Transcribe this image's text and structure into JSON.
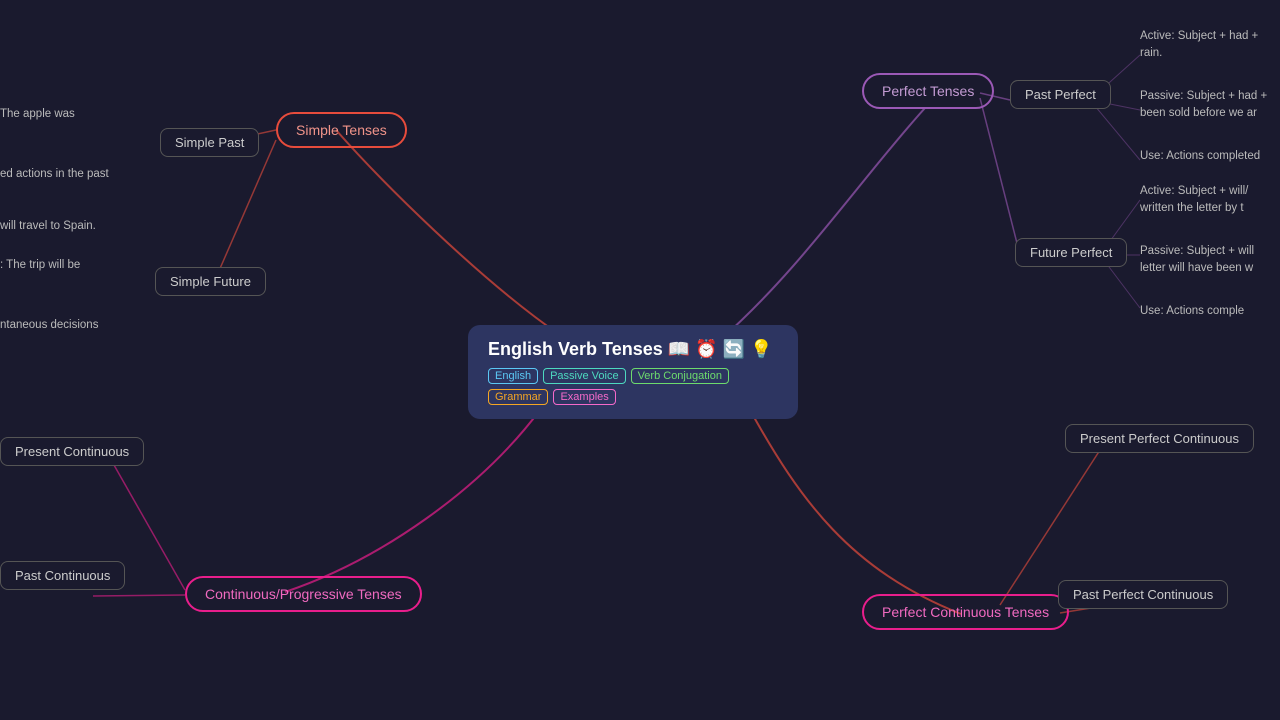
{
  "central": {
    "title": "English Verb Tenses 📖 ⏰ 🔄 💡",
    "tags": [
      {
        "label": "English",
        "class": "tag-blue"
      },
      {
        "label": "Passive Voice",
        "class": "tag-teal"
      },
      {
        "label": "Verb Conjugation",
        "class": "tag-green"
      },
      {
        "label": "Grammar",
        "class": "tag-orange"
      },
      {
        "label": "Examples",
        "class": "tag-pink"
      }
    ]
  },
  "nodes": {
    "simple_tenses": "Simple Tenses",
    "simple_past": "Simple Past",
    "simple_future": "Simple Future",
    "perfect_tenses": "Perfect Tenses",
    "past_perfect": "Past Perfect",
    "future_perfect": "Future Perfect",
    "continuous_tenses": "Continuous/Progressive Tenses",
    "present_continuous": "Present Continuous",
    "past_continuous": "Past Continuous",
    "perfect_continuous_tenses": "Perfect Continuous Tenses",
    "present_perfect_continuous": "Present Perfect Continuous",
    "past_perfect_continuous": "Past Perfect Continuous"
  },
  "text_nodes": {
    "apple": "The apple was",
    "ed_actions": "ed actions in the past",
    "will_travel": "will travel to Spain.",
    "trip_will": ": The trip will be",
    "instantaneous": "ntaneous decisions",
    "active_had": "Active: Subject + had +",
    "active_had2": "rain.",
    "passive_had": "Passive: Subject + had +",
    "passive_had2": "been sold before we ar",
    "use_actions_completed": "Use: Actions completed",
    "active_will": "Active: Subject + will/",
    "active_will2": "written the letter by t",
    "passive_will": "Passive: Subject + will",
    "passive_will2": "letter will have been w",
    "use_actions_comp2": "Use: Actions comple"
  },
  "colors": {
    "bg": "#1a1a2e",
    "central_bg": "#2d3561",
    "purple": "#9b59b6",
    "red": "#e74c3c",
    "pink": "#e91e8c",
    "text": "#cccccc"
  }
}
